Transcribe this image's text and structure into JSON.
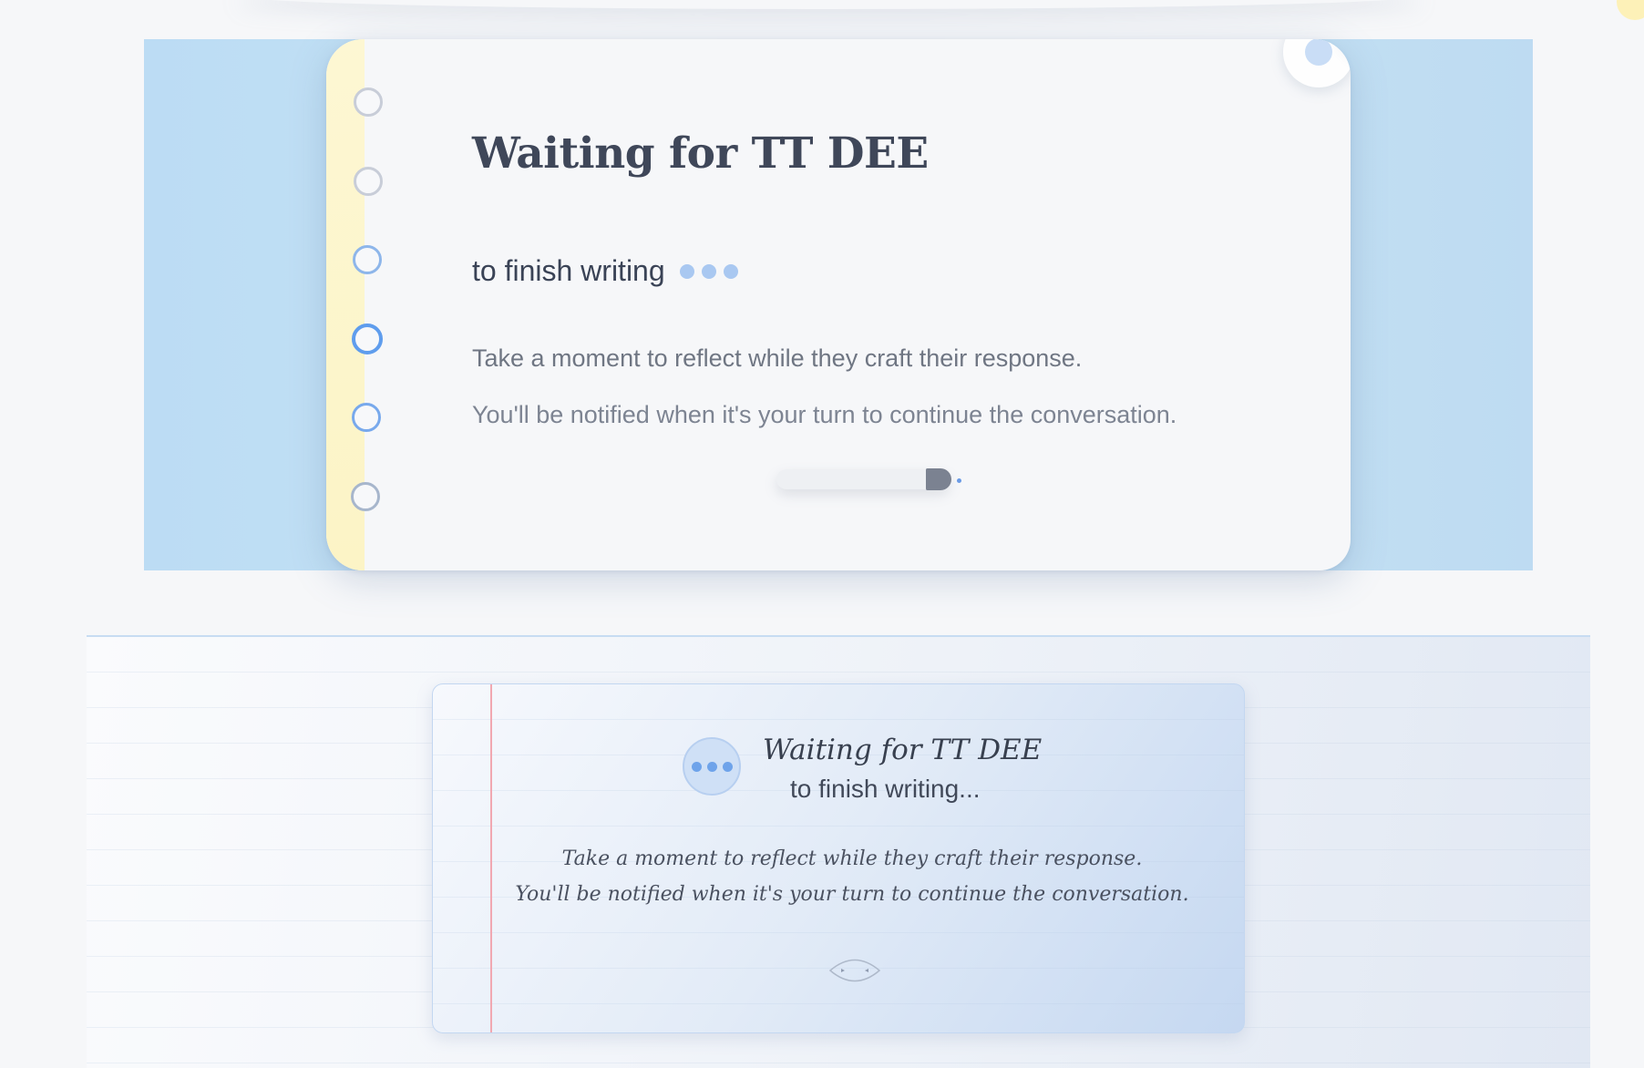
{
  "top_card": {
    "title": "Waiting for TT DEE",
    "subtitle": "to finish writing",
    "line1": "Take a moment to reflect while they craft their response.",
    "line2": "You'll be notified when it's your turn to continue the conversation.",
    "ring_count": 6,
    "icons": [
      "notebook-ring-icon",
      "typing-dots-icon",
      "pen-icon",
      "bubble-icon"
    ]
  },
  "bottom_card": {
    "title": "Waiting for TT DEE",
    "subtitle": "to finish writing...",
    "line1": "Take a moment to reflect while they craft their response.",
    "line2": "You'll be notified when it's your turn to continue the conversation.",
    "icons": [
      "typing-dots-icon",
      "eye-icon"
    ]
  },
  "colors": {
    "accent_blue": "#6ea3ea",
    "spine_yellow": "#fcf4c6",
    "margin_red": "#f1a8b1",
    "title_slate": "#3f4759"
  }
}
